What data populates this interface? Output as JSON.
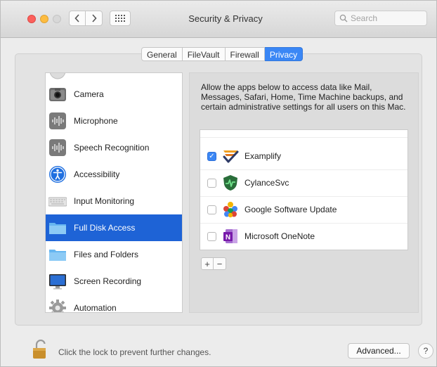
{
  "window": {
    "title": "Security & Privacy"
  },
  "search": {
    "placeholder": "Search"
  },
  "tabs": [
    {
      "label": "General",
      "active": false
    },
    {
      "label": "FileVault",
      "active": false
    },
    {
      "label": "Firewall",
      "active": false
    },
    {
      "label": "Privacy",
      "active": true
    }
  ],
  "sidebar": {
    "items": [
      {
        "label": "Camera",
        "icon": "camera-icon"
      },
      {
        "label": "Microphone",
        "icon": "microphone-icon"
      },
      {
        "label": "Speech Recognition",
        "icon": "speech-recognition-icon"
      },
      {
        "label": "Accessibility",
        "icon": "accessibility-icon"
      },
      {
        "label": "Input Monitoring",
        "icon": "keyboard-icon"
      },
      {
        "label": "Full Disk Access",
        "icon": "folder-icon",
        "selected": true
      },
      {
        "label": "Files and Folders",
        "icon": "folder-icon"
      },
      {
        "label": "Screen Recording",
        "icon": "display-icon"
      },
      {
        "label": "Automation",
        "icon": "gear-icon"
      }
    ]
  },
  "main": {
    "description": "Allow the apps below to access data like Mail, Messages, Safari, Home, Time Machine backups, and certain administrative settings for all users on this Mac.",
    "apps": [
      {
        "name": "Examplify",
        "checked": true,
        "icon": "examplify-icon"
      },
      {
        "name": "CylanceSvc",
        "checked": false,
        "icon": "cylance-icon"
      },
      {
        "name": "Google Software Update",
        "checked": false,
        "icon": "google-software-update-icon"
      },
      {
        "name": "Microsoft OneNote",
        "checked": false,
        "icon": "onenote-icon"
      }
    ],
    "add_label": "+",
    "remove_label": "−"
  },
  "footer": {
    "lock_text": "Click the lock to prevent further changes.",
    "advanced_label": "Advanced...",
    "help_label": "?"
  },
  "colors": {
    "accent": "#3b87f5",
    "selection": "#1e63d6"
  }
}
